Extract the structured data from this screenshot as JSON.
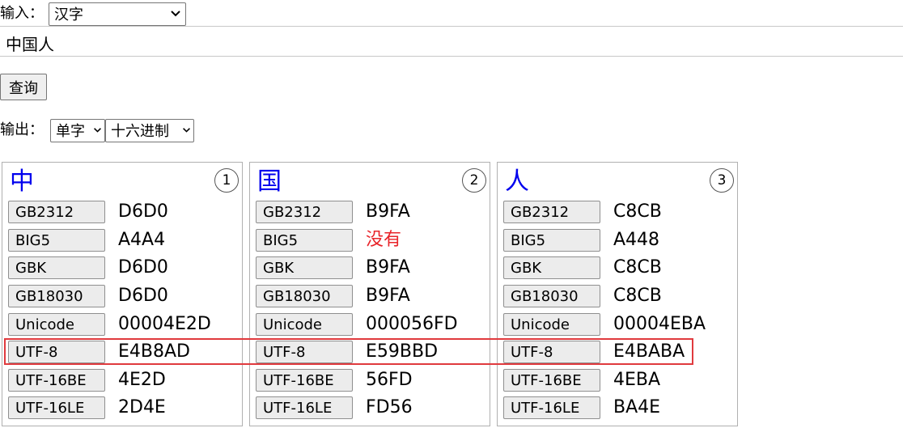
{
  "input": {
    "label": "输入：",
    "type_selected": "汉字",
    "text_value": "中国人"
  },
  "query_button": "查询",
  "output": {
    "label": "输出：",
    "mode_selected": "单字",
    "radix_selected": "十六进制"
  },
  "results": [
    {
      "char": "中",
      "index": "1",
      "encodings": [
        {
          "name": "GB2312",
          "value": "D6D0"
        },
        {
          "name": "BIG5",
          "value": "A4A4"
        },
        {
          "name": "GBK",
          "value": "D6D0"
        },
        {
          "name": "GB18030",
          "value": "D6D0"
        },
        {
          "name": "Unicode",
          "value": "00004E2D"
        },
        {
          "name": "UTF-8",
          "value": "E4B8AD"
        },
        {
          "name": "UTF-16BE",
          "value": "4E2D"
        },
        {
          "name": "UTF-16LE",
          "value": "2D4E"
        }
      ]
    },
    {
      "char": "国",
      "index": "2",
      "encodings": [
        {
          "name": "GB2312",
          "value": "B9FA"
        },
        {
          "name": "BIG5",
          "value": "没有"
        },
        {
          "name": "GBK",
          "value": "B9FA"
        },
        {
          "name": "GB18030",
          "value": "B9FA"
        },
        {
          "name": "Unicode",
          "value": "000056FD"
        },
        {
          "name": "UTF-8",
          "value": "E59BBD"
        },
        {
          "name": "UTF-16BE",
          "value": "56FD"
        },
        {
          "name": "UTF-16LE",
          "value": "FD56"
        }
      ]
    },
    {
      "char": "人",
      "index": "3",
      "encodings": [
        {
          "name": "GB2312",
          "value": "C8CB"
        },
        {
          "name": "BIG5",
          "value": "A448"
        },
        {
          "name": "GBK",
          "value": "C8CB"
        },
        {
          "name": "GB18030",
          "value": "C8CB"
        },
        {
          "name": "Unicode",
          "value": "00004EBA"
        },
        {
          "name": "UTF-8",
          "value": "E4BABA"
        },
        {
          "name": "UTF-16BE",
          "value": "4EBA"
        },
        {
          "name": "UTF-16LE",
          "value": "BA4E"
        }
      ]
    }
  ],
  "colors": {
    "char_blue": "#0000ee",
    "missing_red": "#e8242a",
    "highlight_red": "#e03a3e"
  },
  "icons": {
    "select_arrow": "chevron-down-icon"
  },
  "highlight": {
    "row": "UTF-8"
  }
}
